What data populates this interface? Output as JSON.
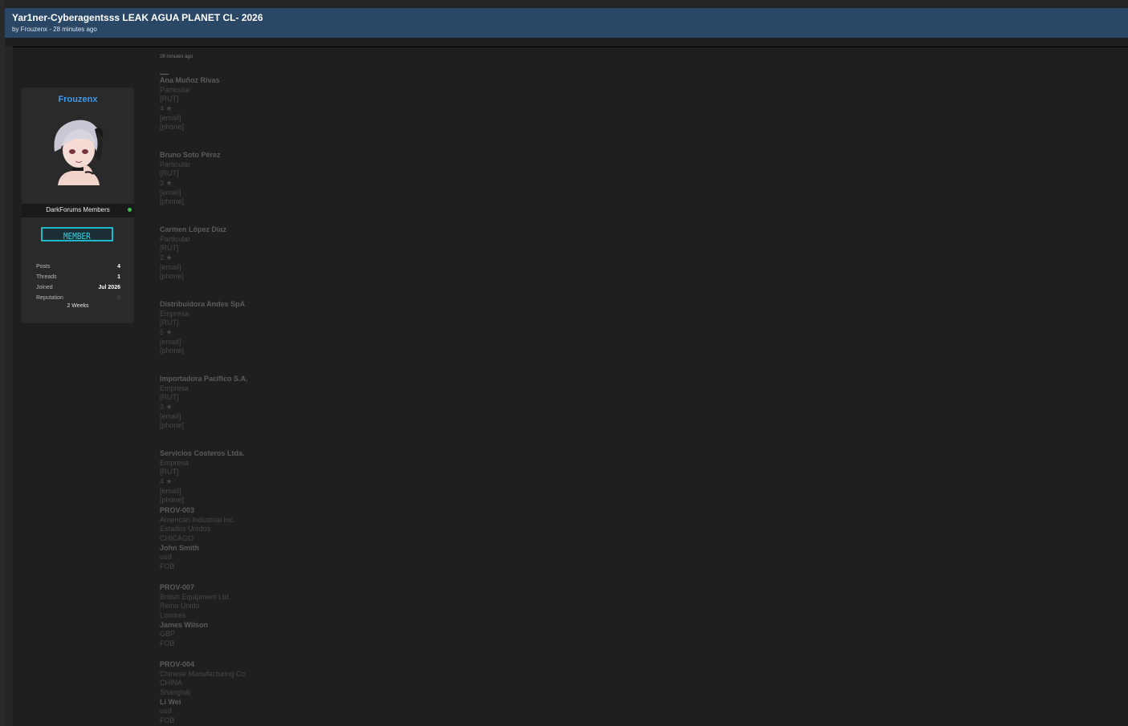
{
  "thread": {
    "title": "Yar1ner-Cyberagentsss LEAK AGUA PLANET CL- 2026",
    "meta": "by Frouzenx - 28 minutes ago"
  },
  "author": {
    "name": "Frouzenx",
    "avatar": "anime-girl-avatar",
    "group": "DarkForums Members",
    "status_color": "#39c04a",
    "badge": "MEMBER",
    "stats": [
      {
        "label": "Posts",
        "value": "4"
      },
      {
        "label": "Threads",
        "value": "1"
      },
      {
        "label": "Joined",
        "value": "Jul 2026"
      },
      {
        "label": "Reputation",
        "value": "0"
      }
    ],
    "tenure": "2 Weeks"
  },
  "post": {
    "time": "28 minutes ago",
    "entries": [
      [
        "Ana Muñoz Rivas",
        "Particular",
        "[RUT]",
        "4 ★",
        "[email]",
        "[phone]"
      ],
      [
        "Bruno Soto Pérez",
        "Particular",
        "[RUT]",
        "3 ★",
        "[email]",
        "[phone]"
      ],
      [
        "Carmen López Díaz",
        "Particular",
        "[RUT]",
        "2 ★",
        "[email]",
        "[phone]"
      ],
      [
        "Distribuidora Andes SpA",
        "Empresa",
        "[RUT]",
        "5 ★",
        "[email]",
        "[phone]"
      ],
      [
        "Importadora Pacífico S.A.",
        "Empresa",
        "[RUT]",
        "3 ★",
        "[email]",
        "[phone]"
      ],
      [
        "Servicios Costeros Ltda.",
        "Empresa",
        "[RUT]",
        "4 ★",
        "[email]",
        "[phone]"
      ],
      [
        "PROV-003",
        "American Industrial Inc.",
        "Estados Unidos",
        "CHICAGO",
        "John Smith",
        "usd",
        "FOB"
      ],
      [
        "PROV-007",
        "British Equipment Ltd.",
        "Reino Unido",
        "Londres",
        "James Wilson",
        "GBP",
        "FOB"
      ],
      [
        "PROV-004",
        "Chinese Manufacturing Co.",
        "CHINA",
        "Shanghái",
        "Li Wei",
        "usd",
        "FOB"
      ]
    ]
  }
}
